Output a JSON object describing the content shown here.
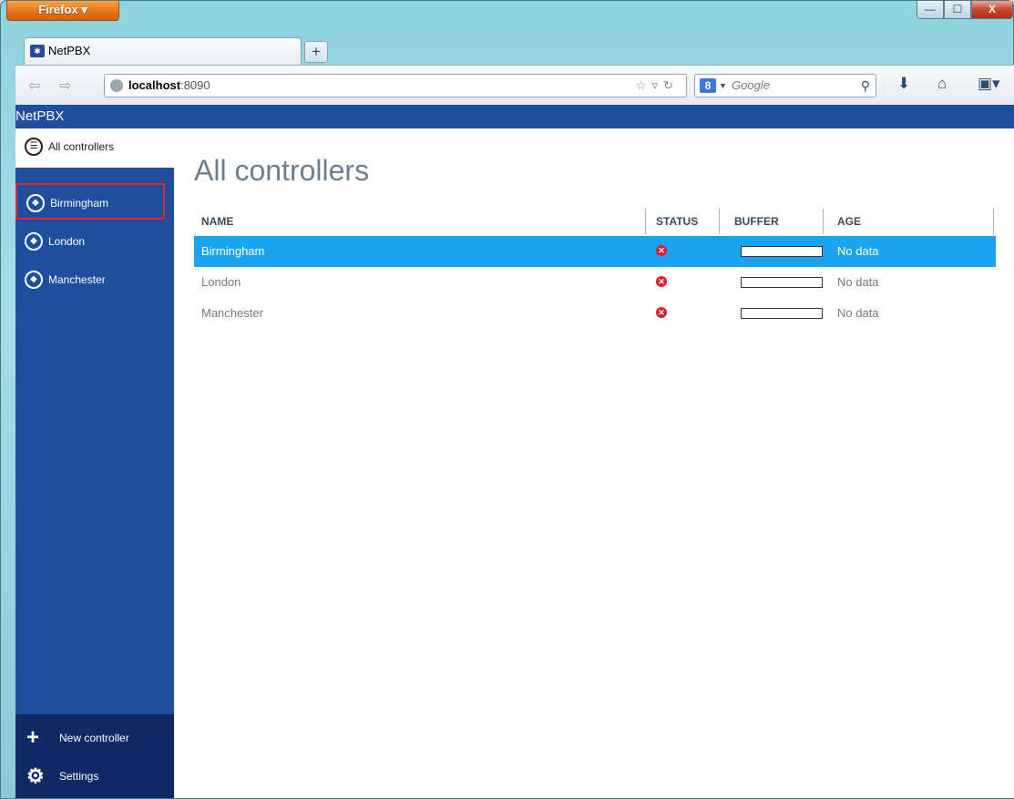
{
  "browser": {
    "menu_label": "Firefox ▾",
    "tab_title": "NetPBX",
    "new_tab": "+",
    "url_host": "localhost",
    "url_port": ":8090",
    "search_placeholder": "Google",
    "window_controls": {
      "minimize": "—",
      "maximize": "☐",
      "close": "X"
    }
  },
  "app": {
    "title": "NetPBX"
  },
  "sidebar": {
    "all_label": "All controllers",
    "items": [
      {
        "label": "Birmingham",
        "selected": true
      },
      {
        "label": "London"
      },
      {
        "label": "Manchester"
      }
    ],
    "footer": [
      {
        "label": "New controller",
        "icon": "plus-icon"
      },
      {
        "label": "Settings",
        "icon": "gear-icon"
      }
    ]
  },
  "main": {
    "title": "All controllers",
    "columns": [
      "NAME",
      "STATUS",
      "BUFFER",
      "AGE"
    ],
    "rows": [
      {
        "name": "Birmingham",
        "status": "error",
        "buffer": 0,
        "age": "No data",
        "selected": true
      },
      {
        "name": "London",
        "status": "error",
        "buffer": 0,
        "age": "No data"
      },
      {
        "name": "Manchester",
        "status": "error",
        "buffer": 0,
        "age": "No data"
      }
    ]
  },
  "colors": {
    "sidebar_bg": "#1f4e9e",
    "sidebar_footer_bg": "#0f2a66",
    "row_selected": "#1aa3f0",
    "status_error": "#dd1e2f",
    "highlight_border": "#e22828"
  }
}
